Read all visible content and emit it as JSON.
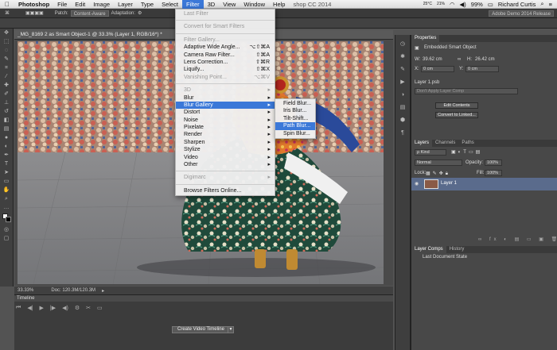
{
  "menubar": {
    "apple": "",
    "items": [
      "Photoshop",
      "File",
      "Edit",
      "Image",
      "Layer",
      "Type",
      "Select",
      "Filter",
      "3D",
      "View",
      "Window",
      "Help"
    ],
    "active": "Filter",
    "status": {
      "title_partial": "shop CC 2014",
      "temp": "25°C",
      "date_small": "21%",
      "battery": "99%",
      "user": "Richard Curtis"
    }
  },
  "optbar": {
    "patch_label": "Patch:",
    "patch_value": "Content-Aware",
    "adaptation_label": "Adaptation:",
    "workspace": "Adobe Demo 2014 Release"
  },
  "document": {
    "tab_title": "_MG_8169 2 as Smart Object-1 @ 33.3% (Layer 1, RGB/16*) *",
    "zoom": "33.33%",
    "doc_size": "Doc: 120.3M/120.3M"
  },
  "filter_menu": {
    "items": [
      {
        "label": "Last Filter",
        "shortcut": "",
        "disabled": true
      },
      {
        "sep": true
      },
      {
        "label": "Convert for Smart Filters",
        "disabled": true
      },
      {
        "sep": true
      },
      {
        "label": "Filter Gallery...",
        "disabled": true
      },
      {
        "label": "Adaptive Wide Angle...",
        "shortcut": "⌥⇧⌘A"
      },
      {
        "label": "Camera Raw Filter...",
        "shortcut": "⇧⌘A"
      },
      {
        "label": "Lens Correction...",
        "shortcut": "⇧⌘R"
      },
      {
        "label": "Liquify...",
        "shortcut": "⇧⌘X"
      },
      {
        "label": "Vanishing Point...",
        "shortcut": "⌥⌘V",
        "disabled": true
      },
      {
        "sep": true
      },
      {
        "label": "3D",
        "disabled": true,
        "submenu": true
      },
      {
        "label": "Blur",
        "submenu": true
      },
      {
        "label": "Blur Gallery",
        "submenu": true,
        "highlight": true
      },
      {
        "label": "Distort",
        "submenu": true
      },
      {
        "label": "Noise",
        "submenu": true
      },
      {
        "label": "Pixelate",
        "submenu": true
      },
      {
        "label": "Render",
        "submenu": true
      },
      {
        "label": "Sharpen",
        "submenu": true
      },
      {
        "label": "Stylize",
        "submenu": true
      },
      {
        "label": "Video",
        "submenu": true
      },
      {
        "label": "Other",
        "submenu": true
      },
      {
        "sep": true
      },
      {
        "label": "Digimarc",
        "disabled": true,
        "submenu": true
      },
      {
        "sep": true
      },
      {
        "label": "Browse Filters Online..."
      }
    ]
  },
  "blur_gallery_menu": {
    "items": [
      {
        "label": "Field Blur..."
      },
      {
        "label": "Iris Blur..."
      },
      {
        "label": "Tilt-Shift..."
      },
      {
        "label": "Path Blur...",
        "highlight": true
      },
      {
        "label": "Spin Blur..."
      }
    ]
  },
  "properties": {
    "tab": "Properties",
    "header": "Embedded Smart Object",
    "w_label": "W:",
    "w_value": "39.62 cm",
    "h_label": "H:",
    "h_value": "26.42 cm",
    "x_label": "X:",
    "x_value": "0 cm",
    "y_label": "Y:",
    "y_value": "0 cm",
    "file": "Layer 1.psb",
    "comp_placeholder": "Don't Apply Layer Comp",
    "edit_btn": "Edit Contents",
    "convert_btn": "Convert to Linked..."
  },
  "layers": {
    "tabs": [
      "Layers",
      "Channels",
      "Paths"
    ],
    "kind": "ρ Kind",
    "blend": "Normal",
    "opacity_label": "Opacity:",
    "opacity_value": "100%",
    "lock_label": "Lock:",
    "fill_label": "Fill:",
    "fill_value": "100%",
    "layer_name": "Layer 1"
  },
  "layer_comps": {
    "tabs": [
      "Layer Comps",
      "History"
    ],
    "last_state": "Last Document State"
  },
  "timeline": {
    "title": "Timeline",
    "create_btn": "Create Video Timeline"
  },
  "colors": {
    "menu_highlight": "#3b78d8",
    "layer_selected": "#5a6b8c"
  }
}
